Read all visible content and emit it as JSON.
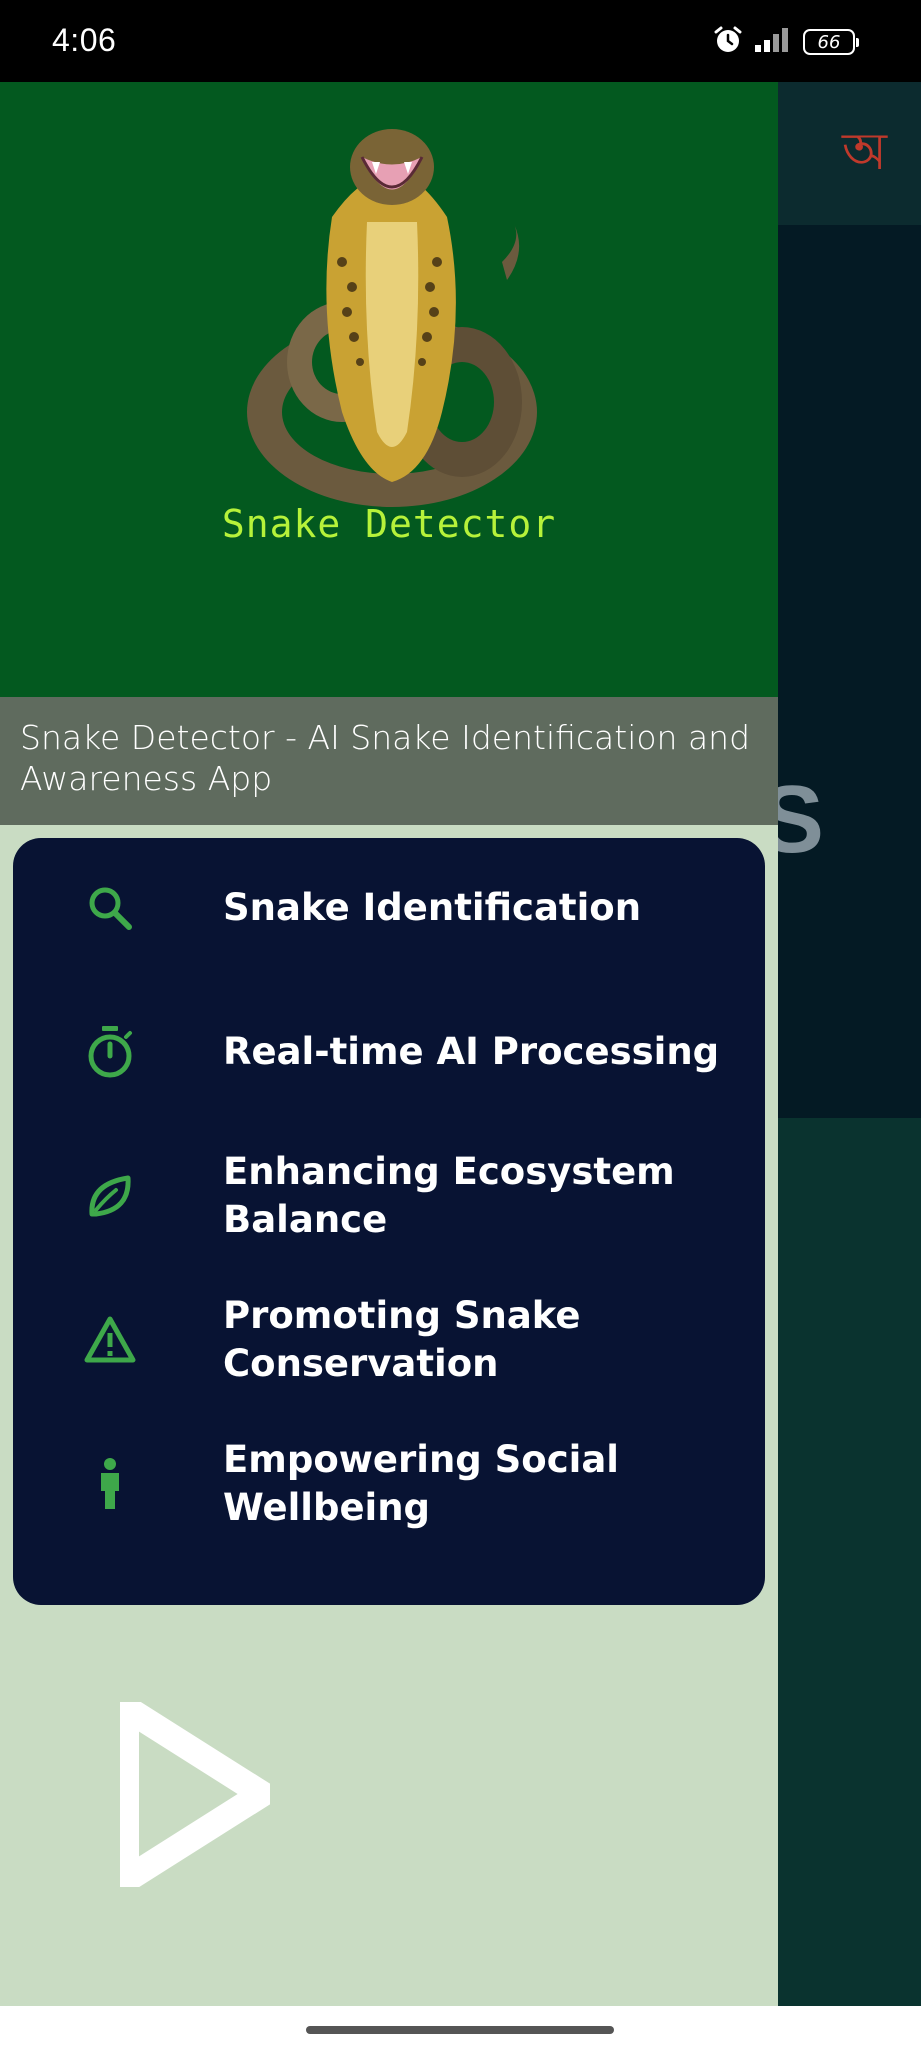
{
  "status_bar": {
    "time": "4:06",
    "battery": "66",
    "icons": [
      "alarm-icon",
      "signal-icon",
      "battery-icon"
    ]
  },
  "background_app": {
    "language_toggle": "অ",
    "hero_letter": "S"
  },
  "drawer": {
    "header": {
      "logo_text": "Snake  Detector",
      "subtitle": "Snake Detector - AI Snake Identification and Awareness App"
    },
    "menu": [
      {
        "icon": "search-icon",
        "label": "Snake Identification"
      },
      {
        "icon": "timer-icon",
        "label": "Real-time AI Processing"
      },
      {
        "icon": "leaf-icon",
        "label": "Enhancing Ecosystem Balance"
      },
      {
        "icon": "warning-icon",
        "label": "Promoting Snake Conservation"
      },
      {
        "icon": "person-icon",
        "label": "Empowering Social Wellbeing"
      }
    ],
    "play_icon": "play-icon"
  },
  "colors": {
    "header_green": "#03591f",
    "drawer_bg": "#c9dcc3",
    "menu_card": "#081333",
    "icon_green": "#3ea84a",
    "logo_text": "#b6f23a"
  }
}
